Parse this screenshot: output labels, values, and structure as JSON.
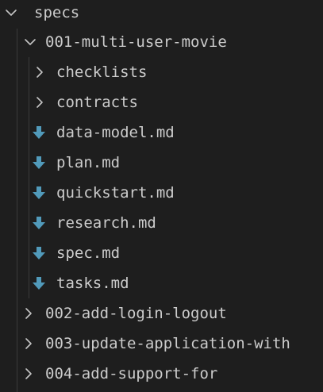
{
  "explorer": {
    "root": {
      "label": "specs",
      "expanded": true,
      "icon": "chevron-down-icon"
    },
    "folders": [
      {
        "label": "001-multi-user-movie",
        "expanded": true,
        "icon": "chevron-down-icon",
        "children": [
          {
            "label": "checklists",
            "type": "folder",
            "expanded": false,
            "icon": "chevron-right-icon"
          },
          {
            "label": "contracts",
            "type": "folder",
            "expanded": false,
            "icon": "chevron-right-icon"
          },
          {
            "label": "data-model.md",
            "type": "file",
            "icon": "markdown-download-icon"
          },
          {
            "label": "plan.md",
            "type": "file",
            "icon": "markdown-download-icon"
          },
          {
            "label": "quickstart.md",
            "type": "file",
            "icon": "markdown-download-icon"
          },
          {
            "label": "research.md",
            "type": "file",
            "icon": "markdown-download-icon"
          },
          {
            "label": "spec.md",
            "type": "file",
            "icon": "markdown-download-icon"
          },
          {
            "label": "tasks.md",
            "type": "file",
            "icon": "markdown-download-icon"
          }
        ]
      },
      {
        "label": "002-add-login-logout",
        "expanded": false,
        "icon": "chevron-right-icon"
      },
      {
        "label": "003-update-application-with",
        "expanded": false,
        "icon": "chevron-right-icon"
      },
      {
        "label": "004-add-support-for",
        "expanded": false,
        "icon": "chevron-right-icon"
      }
    ]
  },
  "colors": {
    "background": "#1e1e1e",
    "text": "#cccccc",
    "chevron": "#c5c5c5",
    "markdown_icon": "#519aba",
    "indent_guide": "#3a3a3a"
  }
}
